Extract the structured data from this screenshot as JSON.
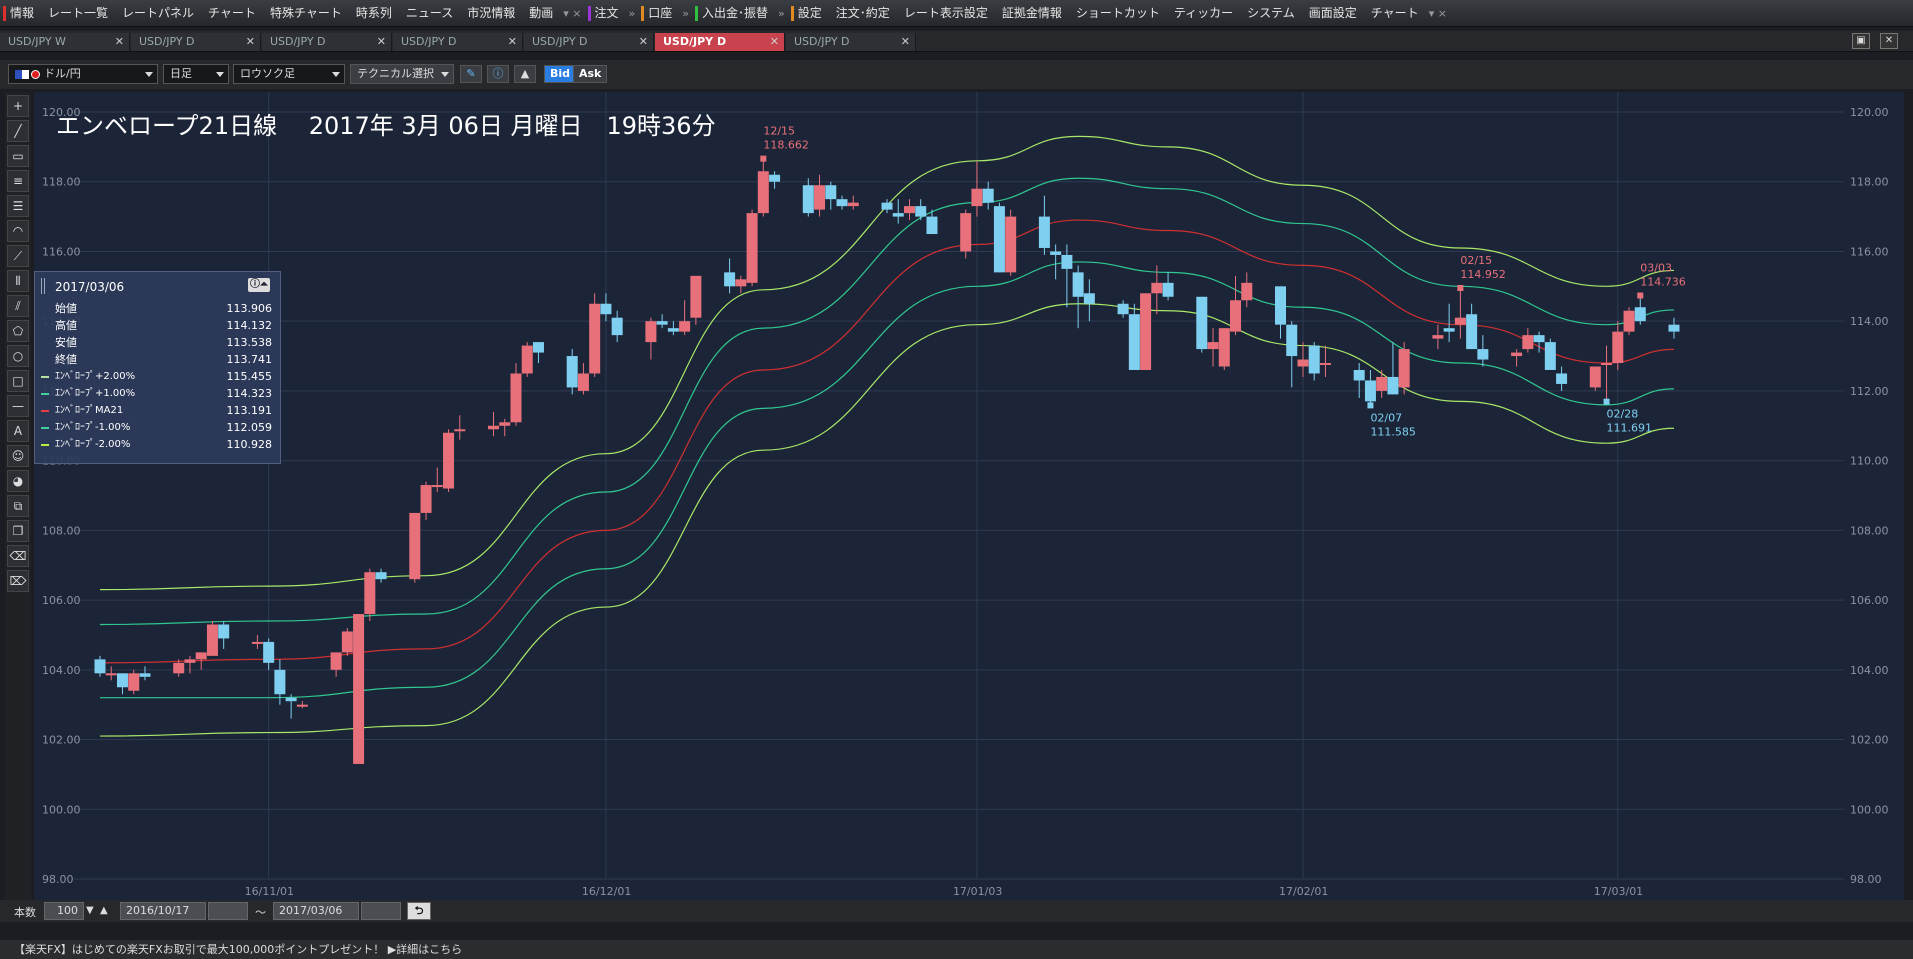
{
  "menu": {
    "items": [
      {
        "label": "情報",
        "mark": "#e03030"
      },
      {
        "label": "レート一覧"
      },
      {
        "label": "レートパネル"
      },
      {
        "label": "チャート"
      },
      {
        "label": "特殊チャート"
      },
      {
        "label": "時系列"
      },
      {
        "label": "ニュース"
      },
      {
        "label": "市況情報"
      },
      {
        "label": "動画"
      },
      {
        "label": "▾ ×",
        "sep": true
      },
      {
        "label": "注文",
        "mark": "#9b35d8"
      },
      {
        "label": "»",
        "sep": true
      },
      {
        "label": "口座",
        "mark": "#e08a20"
      },
      {
        "label": "»",
        "sep": true
      },
      {
        "label": "入出金･振替",
        "mark": "#30c040"
      },
      {
        "label": "»",
        "sep": true
      },
      {
        "label": "設定",
        "mark": "#e08a20"
      },
      {
        "label": "注文･約定"
      },
      {
        "label": "レート表示設定"
      },
      {
        "label": "証拠金情報"
      },
      {
        "label": "ショートカット"
      },
      {
        "label": "ティッカー"
      },
      {
        "label": "システム"
      },
      {
        "label": "画面設定"
      },
      {
        "label": "チャート"
      },
      {
        "label": "▾ ×",
        "sep": true
      }
    ]
  },
  "tabs": [
    {
      "label": "USD/JPY W",
      "active": false
    },
    {
      "label": "USD/JPY D",
      "active": false
    },
    {
      "label": "USD/JPY D",
      "active": false
    },
    {
      "label": "USD/JPY D",
      "active": false
    },
    {
      "label": "USD/JPY D",
      "active": false
    },
    {
      "label": "USD/JPY D",
      "active": true
    },
    {
      "label": "USD/JPY D",
      "active": false
    }
  ],
  "toolbar": {
    "pair": "ドル/円",
    "period": "日足",
    "chart_type": "ロウソク足",
    "technical": "テクニカル選択",
    "bid": "Bid",
    "ask": "Ask"
  },
  "chart": {
    "title": "エンベロープ21日線　 2017年 3月 06日 月曜日　19時36分"
  },
  "info": {
    "date": "2017/03/06",
    "rows": [
      {
        "label": "始値",
        "value": "113.906"
      },
      {
        "label": "高値",
        "value": "114.132"
      },
      {
        "label": "安値",
        "value": "113.538"
      },
      {
        "label": "終値",
        "value": "113.741"
      },
      {
        "label": "ｴﾝﾍﾞﾛｰﾌﾟ+2.00%",
        "value": "115.455",
        "color": "#b8e0a0"
      },
      {
        "label": "ｴﾝﾍﾞﾛｰﾌﾟ+1.00%",
        "value": "114.323",
        "color": "#40d0a0"
      },
      {
        "label": "ｴﾝﾍﾞﾛｰﾌﾟMA21",
        "value": "113.191",
        "color": "#e04040"
      },
      {
        "label": "ｴﾝﾍﾞﾛｰﾌﾟ-1.00%",
        "value": "112.059",
        "color": "#40d0a0"
      },
      {
        "label": "ｴﾝﾍﾞﾛｰﾌﾟ-2.00%",
        "value": "110.928",
        "color": "#b8f040"
      }
    ]
  },
  "bottom": {
    "count_label": "本数",
    "count_value": "100",
    "from_date": "2016/10/17",
    "tilde": "～",
    "to_date": "2017/03/06"
  },
  "status": "【楽天FX】はじめての楽天FXお取引で最大100,000ポイントプレゼント！ ▶詳細はこちら",
  "colors": {
    "up": "#e8707a",
    "down": "#7ecff0",
    "ma": "#d03030",
    "band1": "#30c890",
    "band2": "#a8e868",
    "bg": "#1c2538"
  },
  "chart_data": {
    "type": "candlestick",
    "ylim": [
      98.0,
      120.0
    ],
    "y_ticks": [
      "98.00",
      "100.00",
      "102.00",
      "104.00",
      "106.00",
      "108.00",
      "110.00",
      "112.00",
      "114.00",
      "116.00",
      "118.00",
      "120.00"
    ],
    "x_ticks": [
      {
        "date": "2016-11-01",
        "label": "16/11/01"
      },
      {
        "date": "2016-12-01",
        "label": "16/12/01"
      },
      {
        "date": "2017-01-03",
        "label": "17/01/03"
      },
      {
        "date": "2017-02-01",
        "label": "17/02/01"
      },
      {
        "date": "2017-03-01",
        "label": "17/03/01"
      }
    ],
    "candles": [
      [
        "2016-10-17",
        104.3,
        104.4,
        103.8,
        103.9
      ],
      [
        "2016-10-18",
        103.9,
        104.1,
        103.7,
        103.9
      ],
      [
        "2016-10-19",
        103.9,
        103.9,
        103.3,
        103.5
      ],
      [
        "2016-10-20",
        103.4,
        104.0,
        103.3,
        103.9
      ],
      [
        "2016-10-21",
        103.9,
        104.1,
        103.7,
        103.8
      ],
      [
        "2016-10-24",
        103.9,
        104.3,
        103.8,
        104.2
      ],
      [
        "2016-10-25",
        104.2,
        104.4,
        103.9,
        104.3
      ],
      [
        "2016-10-26",
        104.3,
        104.5,
        104.0,
        104.5
      ],
      [
        "2016-10-27",
        104.4,
        105.4,
        104.4,
        105.3
      ],
      [
        "2016-10-28",
        105.3,
        105.4,
        104.6,
        104.9
      ],
      [
        "2016-10-31",
        104.8,
        105.0,
        104.6,
        104.8
      ],
      [
        "2016-11-01",
        104.8,
        104.9,
        104.0,
        104.2
      ],
      [
        "2016-11-02",
        104.0,
        104.3,
        103.0,
        103.3
      ],
      [
        "2016-11-03",
        103.2,
        103.3,
        102.6,
        103.1
      ],
      [
        "2016-11-04",
        103.0,
        103.1,
        102.9,
        103.0
      ],
      [
        "2016-11-07",
        104.0,
        104.5,
        103.8,
        104.5
      ],
      [
        "2016-11-08",
        104.5,
        105.2,
        104.4,
        105.1
      ],
      [
        "2016-11-09",
        101.3,
        105.2,
        101.3,
        105.6
      ],
      [
        "2016-11-10",
        105.6,
        106.9,
        105.4,
        106.8
      ],
      [
        "2016-11-11",
        106.8,
        106.9,
        106.5,
        106.6
      ],
      [
        "2016-11-14",
        106.6,
        108.5,
        106.5,
        108.5
      ],
      [
        "2016-11-15",
        108.5,
        109.4,
        108.3,
        109.3
      ],
      [
        "2016-11-16",
        109.3,
        109.8,
        109.1,
        109.3
      ],
      [
        "2016-11-17",
        109.2,
        110.9,
        109.1,
        110.8
      ],
      [
        "2016-11-18",
        110.9,
        111.3,
        110.6,
        110.9
      ],
      [
        "2016-11-21",
        110.9,
        111.4,
        110.7,
        111.0
      ],
      [
        "2016-11-22",
        111.0,
        111.2,
        110.7,
        111.1
      ],
      [
        "2016-11-23",
        111.1,
        112.8,
        111.0,
        112.5
      ],
      [
        "2016-11-24",
        112.5,
        113.4,
        112.4,
        113.3
      ],
      [
        "2016-11-25",
        113.4,
        113.4,
        112.8,
        113.1
      ],
      [
        "2016-11-28",
        113.0,
        113.2,
        111.9,
        112.1
      ],
      [
        "2016-11-29",
        112.0,
        112.8,
        111.9,
        112.5
      ],
      [
        "2016-11-30",
        112.5,
        114.8,
        112.4,
        114.5
      ],
      [
        "2016-12-01",
        114.5,
        114.8,
        114.0,
        114.2
      ],
      [
        "2016-12-02",
        114.1,
        114.3,
        113.4,
        113.6
      ],
      [
        "2016-12-05",
        113.4,
        114.1,
        112.9,
        114.0
      ],
      [
        "2016-12-06",
        114.0,
        114.2,
        113.8,
        113.9
      ],
      [
        "2016-12-07",
        113.8,
        114.0,
        113.6,
        113.7
      ],
      [
        "2016-12-08",
        113.7,
        114.6,
        113.6,
        114.0
      ],
      [
        "2016-12-09",
        114.1,
        115.2,
        113.9,
        115.3
      ],
      [
        "2016-12-12",
        115.4,
        115.8,
        114.8,
        115.0
      ],
      [
        "2016-12-13",
        115.0,
        115.3,
        114.8,
        115.2
      ],
      [
        "2016-12-14",
        115.1,
        117.2,
        115.0,
        117.1
      ],
      [
        "2016-12-15",
        117.1,
        118.7,
        117.0,
        118.3
      ],
      [
        "2016-12-16",
        118.2,
        118.3,
        117.8,
        118.0
      ],
      [
        "2016-12-19",
        117.9,
        118.1,
        117.0,
        117.1
      ],
      [
        "2016-12-20",
        117.2,
        118.2,
        117.0,
        117.9
      ],
      [
        "2016-12-21",
        117.9,
        118.0,
        117.2,
        117.5
      ],
      [
        "2016-12-22",
        117.5,
        117.6,
        117.2,
        117.3
      ],
      [
        "2016-12-23",
        117.3,
        117.6,
        117.2,
        117.4
      ],
      [
        "2016-12-26",
        117.4,
        117.5,
        117.1,
        117.2
      ],
      [
        "2016-12-27",
        117.1,
        117.5,
        116.8,
        117.0
      ],
      [
        "2016-12-28",
        117.1,
        117.5,
        116.9,
        117.3
      ],
      [
        "2016-12-29",
        117.3,
        117.5,
        116.9,
        117.0
      ],
      [
        "2016-12-30",
        117.0,
        117.2,
        116.5,
        116.5
      ],
      [
        "2017-01-02",
        116.0,
        117.2,
        115.8,
        117.1
      ],
      [
        "2017-01-03",
        117.3,
        118.6,
        117.0,
        117.8
      ],
      [
        "2017-01-04",
        117.8,
        118.0,
        117.2,
        117.4
      ],
      [
        "2017-01-05",
        117.3,
        117.4,
        115.4,
        115.4
      ],
      [
        "2017-01-06",
        115.4,
        117.2,
        115.3,
        117.0
      ],
      [
        "2017-01-09",
        117.0,
        117.6,
        115.9,
        116.1
      ],
      [
        "2017-01-10",
        116.0,
        116.2,
        115.2,
        115.9
      ],
      [
        "2017-01-11",
        115.9,
        116.2,
        114.4,
        115.5
      ],
      [
        "2017-01-12",
        115.4,
        115.6,
        113.8,
        114.7
      ],
      [
        "2017-01-13",
        114.8,
        115.2,
        114.0,
        114.5
      ],
      [
        "2017-01-16",
        114.5,
        114.6,
        114.1,
        114.2
      ],
      [
        "2017-01-17",
        114.2,
        114.5,
        112.6,
        112.6
      ],
      [
        "2017-01-18",
        112.6,
        114.8,
        112.6,
        114.8
      ],
      [
        "2017-01-19",
        114.8,
        115.6,
        114.2,
        115.1
      ],
      [
        "2017-01-20",
        115.1,
        115.4,
        114.6,
        114.7
      ],
      [
        "2017-01-23",
        114.7,
        114.7,
        113.1,
        113.2
      ],
      [
        "2017-01-24",
        113.2,
        113.8,
        112.7,
        113.4
      ],
      [
        "2017-01-25",
        112.7,
        113.8,
        112.6,
        113.8
      ],
      [
        "2017-01-26",
        113.7,
        115.3,
        113.6,
        114.6
      ],
      [
        "2017-01-27",
        114.6,
        115.4,
        114.4,
        115.1
      ],
      [
        "2017-01-30",
        115.0,
        115.0,
        113.5,
        113.9
      ],
      [
        "2017-01-31",
        113.9,
        114.0,
        112.1,
        113.0
      ],
      [
        "2017-02-01",
        112.7,
        113.4,
        112.4,
        112.9
      ],
      [
        "2017-02-02",
        113.3,
        113.4,
        112.3,
        112.5
      ],
      [
        "2017-02-03",
        112.8,
        113.3,
        112.4,
        112.8
      ],
      [
        "2017-02-06",
        112.6,
        112.8,
        111.8,
        112.3
      ],
      [
        "2017-02-07",
        112.3,
        112.6,
        111.6,
        111.7
      ],
      [
        "2017-02-08",
        112.0,
        112.6,
        111.8,
        112.4
      ],
      [
        "2017-02-09",
        112.4,
        113.4,
        111.9,
        111.9
      ],
      [
        "2017-02-10",
        112.1,
        113.4,
        111.9,
        113.2
      ],
      [
        "2017-02-13",
        113.5,
        113.9,
        113.2,
        113.6
      ],
      [
        "2017-02-14",
        113.8,
        114.5,
        113.4,
        113.7
      ],
      [
        "2017-02-15",
        113.9,
        115.0,
        113.5,
        114.1
      ],
      [
        "2017-02-16",
        114.2,
        114.5,
        113.2,
        113.2
      ],
      [
        "2017-02-17",
        113.2,
        113.6,
        112.7,
        112.9
      ],
      [
        "2017-02-20",
        113.0,
        113.2,
        112.7,
        113.1
      ],
      [
        "2017-02-21",
        113.2,
        113.8,
        113.1,
        113.6
      ],
      [
        "2017-02-22",
        113.6,
        113.7,
        113.1,
        113.4
      ],
      [
        "2017-02-23",
        113.4,
        113.5,
        112.6,
        112.6
      ],
      [
        "2017-02-24",
        112.5,
        112.7,
        112.0,
        112.2
      ],
      [
        "2017-02-27",
        112.1,
        112.7,
        112.0,
        112.7
      ],
      [
        "2017-02-28",
        112.8,
        113.3,
        111.7,
        112.8
      ],
      [
        "2017-03-01",
        112.8,
        114.0,
        112.6,
        113.7
      ],
      [
        "2017-03-02",
        113.7,
        114.4,
        113.6,
        114.3
      ],
      [
        "2017-03-03",
        114.4,
        114.7,
        113.9,
        114.0
      ],
      [
        "2017-03-06",
        113.9,
        114.1,
        113.5,
        113.7
      ]
    ],
    "series": [
      {
        "name": "ｴﾝﾍﾞﾛｰﾌﾟ+2.00%",
        "role": "band2",
        "points": [
          [
            "2016-10-17",
            106.3
          ],
          [
            "2016-11-01",
            106.4
          ],
          [
            "2016-11-15",
            106.7
          ],
          [
            "2016-12-01",
            110.2
          ],
          [
            "2016-12-15",
            114.9
          ],
          [
            "2017-01-03",
            118.6
          ],
          [
            "2017-01-12",
            119.3
          ],
          [
            "2017-01-20",
            119.0
          ],
          [
            "2017-02-01",
            117.9
          ],
          [
            "2017-02-15",
            116.1
          ],
          [
            "2017-02-28",
            115.0
          ],
          [
            "2017-03-06",
            115.455
          ]
        ]
      },
      {
        "name": "ｴﾝﾍﾞﾛｰﾌﾟ+1.00%",
        "role": "band1",
        "points": [
          [
            "2016-10-17",
            105.3
          ],
          [
            "2016-11-01",
            105.4
          ],
          [
            "2016-11-15",
            105.6
          ],
          [
            "2016-12-01",
            109.1
          ],
          [
            "2016-12-15",
            113.8
          ],
          [
            "2017-01-03",
            117.4
          ],
          [
            "2017-01-12",
            118.1
          ],
          [
            "2017-01-20",
            117.8
          ],
          [
            "2017-02-01",
            116.8
          ],
          [
            "2017-02-15",
            115.0
          ],
          [
            "2017-02-28",
            113.9
          ],
          [
            "2017-03-06",
            114.323
          ]
        ]
      },
      {
        "name": "ｴﾝﾍﾞﾛｰﾌﾟMA21",
        "role": "ma",
        "points": [
          [
            "2016-10-17",
            104.2
          ],
          [
            "2016-11-01",
            104.3
          ],
          [
            "2016-11-15",
            104.6
          ],
          [
            "2016-12-01",
            108.0
          ],
          [
            "2016-12-15",
            112.6
          ],
          [
            "2017-01-03",
            116.2
          ],
          [
            "2017-01-12",
            116.9
          ],
          [
            "2017-01-20",
            116.6
          ],
          [
            "2017-02-01",
            115.6
          ],
          [
            "2017-02-15",
            113.9
          ],
          [
            "2017-02-28",
            112.8
          ],
          [
            "2017-03-06",
            113.191
          ]
        ]
      },
      {
        "name": "ｴﾝﾍﾞﾛｰﾌﾟ-1.00%",
        "role": "band1",
        "points": [
          [
            "2016-10-17",
            103.2
          ],
          [
            "2016-11-01",
            103.2
          ],
          [
            "2016-11-15",
            103.5
          ],
          [
            "2016-12-01",
            106.9
          ],
          [
            "2016-12-15",
            111.5
          ],
          [
            "2017-01-03",
            115.0
          ],
          [
            "2017-01-12",
            115.7
          ],
          [
            "2017-01-20",
            115.4
          ],
          [
            "2017-02-01",
            114.4
          ],
          [
            "2017-02-15",
            112.8
          ],
          [
            "2017-02-28",
            111.6
          ],
          [
            "2017-03-06",
            112.059
          ]
        ]
      },
      {
        "name": "ｴﾝﾍﾞﾛｰﾌﾟ-2.00%",
        "role": "band2",
        "points": [
          [
            "2016-10-17",
            102.1
          ],
          [
            "2016-11-01",
            102.2
          ],
          [
            "2016-11-15",
            102.4
          ],
          [
            "2016-12-01",
            105.8
          ],
          [
            "2016-12-15",
            110.3
          ],
          [
            "2017-01-03",
            113.9
          ],
          [
            "2017-01-12",
            114.5
          ],
          [
            "2017-01-20",
            114.3
          ],
          [
            "2017-02-01",
            113.3
          ],
          [
            "2017-02-15",
            111.7
          ],
          [
            "2017-02-28",
            110.5
          ],
          [
            "2017-03-06",
            110.928
          ]
        ]
      }
    ],
    "annotations": [
      {
        "date": "2016-12-15",
        "price": 118.662,
        "kind": "high",
        "label_date": "12/15",
        "label_value": "118.662"
      },
      {
        "date": "2017-02-07",
        "price": 111.585,
        "kind": "low",
        "label_date": "02/07",
        "label_value": "111.585"
      },
      {
        "date": "2017-02-15",
        "price": 114.952,
        "kind": "high",
        "label_date": "02/15",
        "label_value": "114.952"
      },
      {
        "date": "2017-02-28",
        "price": 111.691,
        "kind": "low",
        "label_date": "02/28",
        "label_value": "111.691"
      },
      {
        "date": "2017-03-03",
        "price": 114.736,
        "kind": "high",
        "label_date": "03/03",
        "label_value": "114.736"
      }
    ]
  }
}
